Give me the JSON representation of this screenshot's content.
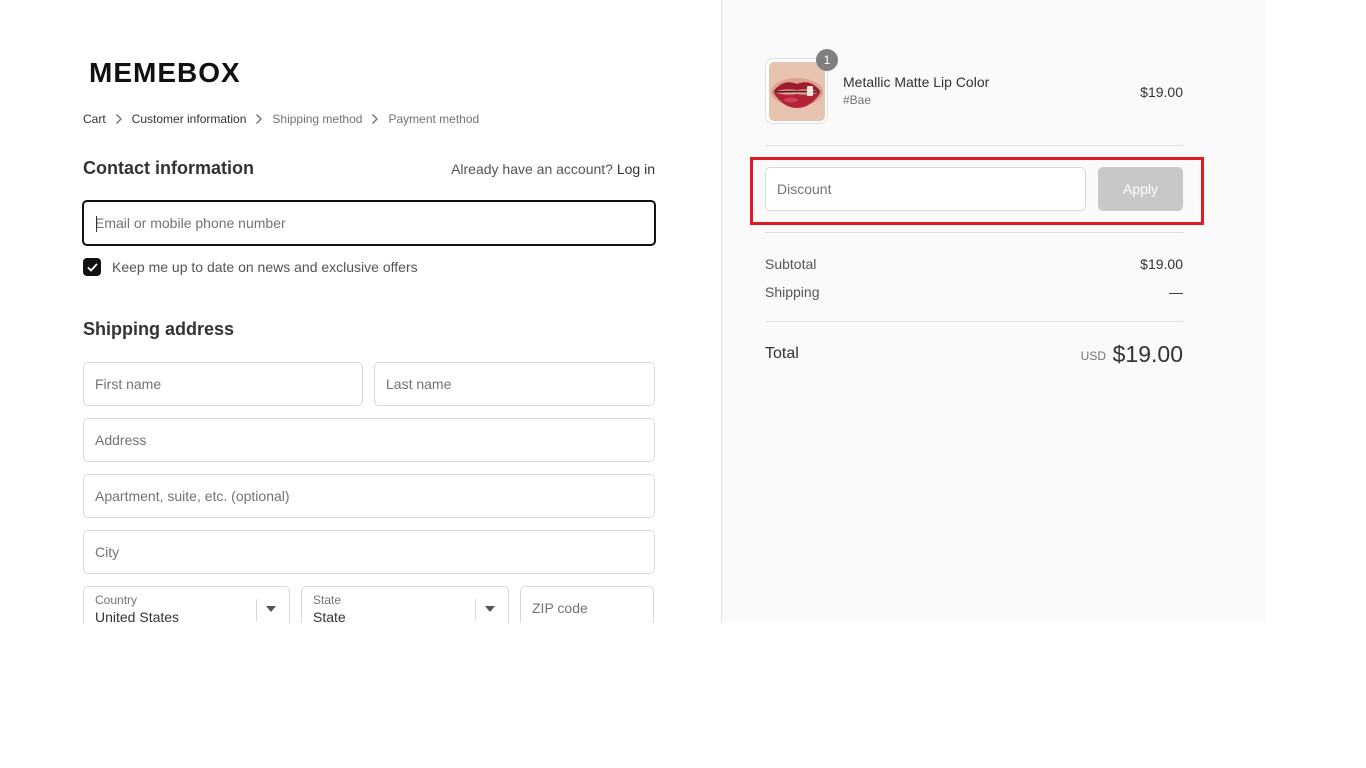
{
  "brand": {
    "logo_text": "MEMEBOX"
  },
  "breadcrumb": {
    "items": [
      {
        "label": "Cart",
        "active": true
      },
      {
        "label": "Customer information",
        "active": true
      },
      {
        "label": "Shipping method",
        "active": false
      },
      {
        "label": "Payment method",
        "active": false
      }
    ]
  },
  "contact": {
    "heading": "Contact information",
    "account_prompt": "Already have an account?",
    "login_label": "Log in",
    "email_placeholder": "Email or mobile phone number",
    "newsletter_label": "Keep me up to date on news and exclusive offers",
    "newsletter_checked": true
  },
  "shipping": {
    "heading": "Shipping address",
    "first_name_placeholder": "First name",
    "last_name_placeholder": "Last name",
    "address_placeholder": "Address",
    "apartment_placeholder": "Apartment, suite, etc. (optional)",
    "city_placeholder": "City",
    "country_label": "Country",
    "country_value": "United States",
    "state_label": "State",
    "state_value": "State",
    "zip_placeholder": "ZIP code"
  },
  "order": {
    "item": {
      "name": "Metallic Matte Lip Color",
      "variant": "#Bae",
      "price": "$19.00",
      "quantity": "1"
    },
    "discount_placeholder": "Discount",
    "apply_label": "Apply",
    "subtotal_label": "Subtotal",
    "subtotal_value": "$19.00",
    "shipping_label": "Shipping",
    "shipping_value": "—",
    "total_label": "Total",
    "total_currency": "USD",
    "total_value": "$19.00"
  },
  "colors": {
    "highlight": "#e01b24",
    "apply_button": "#c8c8c8",
    "summary_background": "#fafafa"
  }
}
